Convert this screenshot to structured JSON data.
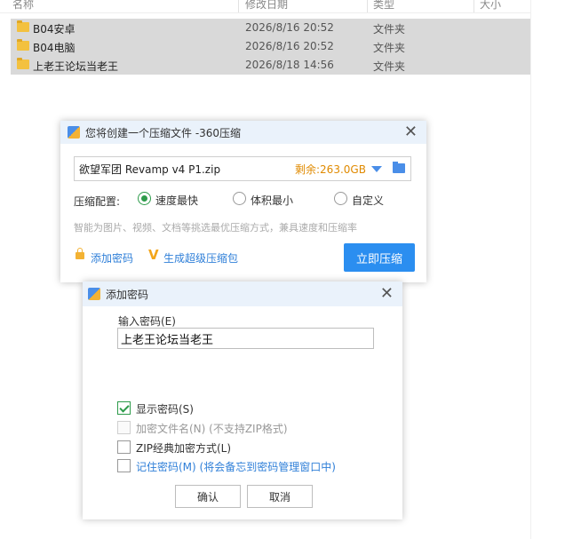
{
  "explorer": {
    "columns": {
      "name": "名称",
      "modified": "修改日期",
      "type": "类型",
      "size": "大小"
    },
    "files": [
      {
        "name": "B04安卓",
        "date": "2026/8/16 20:52",
        "type": "文件夹",
        "icon": "folder-icon"
      },
      {
        "name": "B04电脑",
        "date": "2026/8/16 20:52",
        "type": "文件夹",
        "icon": "folder-icon"
      },
      {
        "name": "上老王论坛当老王",
        "date": "2026/8/18 14:56",
        "type": "文件夹",
        "icon": "folder-icon"
      }
    ]
  },
  "compress_dialog": {
    "title": "您将创建一个压缩文件 -360压缩",
    "filename": "欲望军团 Revamp v4 P1.zip",
    "free_space": "剩余:263.0GB",
    "config_label": "压缩配置:",
    "options": [
      {
        "label": "速度最快",
        "selected": true
      },
      {
        "label": "体积最小",
        "selected": false
      },
      {
        "label": "自定义",
        "selected": false
      }
    ],
    "hint": "智能为图片、视频、文档等挑选最优压缩方式，兼具速度和压缩率",
    "add_password_link": "添加密码",
    "super_pack_link": "生成超级压缩包",
    "compress_button": "立即压缩",
    "accent_color": "#2b8ef0"
  },
  "password_dialog": {
    "title": "添加密码",
    "input_label": "输入密码(E)",
    "password_value": "上老王论坛当老王",
    "checkboxes": [
      {
        "label": "显示密码(S)",
        "checked": true,
        "disabled": false,
        "style": "normal"
      },
      {
        "label": "加密文件名(N) (不支持ZIP格式)",
        "checked": false,
        "disabled": true,
        "style": "disabled"
      },
      {
        "label": "ZIP经典加密方式(L)",
        "checked": false,
        "disabled": false,
        "style": "normal"
      },
      {
        "label": "记住密码(M) (将会备忘到密码管理窗口中)",
        "checked": false,
        "disabled": false,
        "style": "blue"
      }
    ],
    "ok_button": "确认",
    "cancel_button": "取消"
  }
}
